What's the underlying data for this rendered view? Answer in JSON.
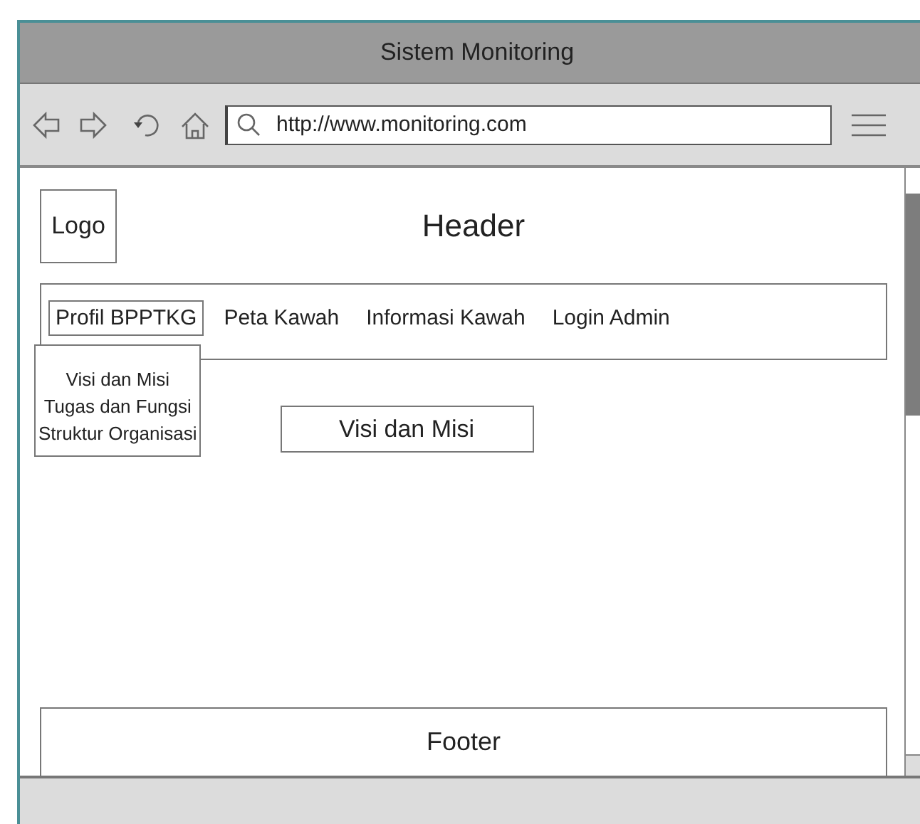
{
  "window": {
    "title": "Sistem Monitoring"
  },
  "toolbar": {
    "url": "http://www.monitoring.com"
  },
  "page": {
    "logo": "Logo",
    "header": "Header",
    "nav": [
      {
        "label": "Profil BPPTKG",
        "selected": true,
        "expanded": true,
        "menu": [
          "Visi dan Misi",
          "Tugas dan Fungsi",
          "Struktur Organisasi"
        ]
      },
      {
        "label": "Peta Kawah",
        "selected": false
      },
      {
        "label": "Informasi Kawah",
        "selected": false
      },
      {
        "label": "Login Admin",
        "selected": false
      }
    ],
    "content_button": "Visi dan Misi",
    "footer": "Footer"
  }
}
